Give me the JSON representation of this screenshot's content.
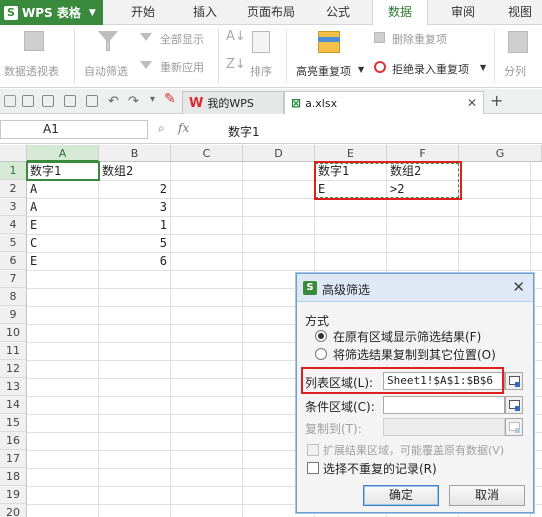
{
  "menubar": {
    "app_title": "WPS 表格",
    "tabs": [
      "开始",
      "插入",
      "页面布局",
      "公式",
      "数据",
      "审阅",
      "视图"
    ],
    "active_tab": "数据"
  },
  "ribbon": {
    "pivot": "数据透视表",
    "autofilter": "自动筛选",
    "show_all": "全部显示",
    "reapply": "重新应用",
    "sort": "排序",
    "highlight_dup": "高亮重复项",
    "remove_dup": "删除重复项",
    "reject_dup": "拒绝录入重复项",
    "split": "分列"
  },
  "doc_tabs": [
    {
      "label": "我的WPS"
    },
    {
      "label": "a.xlsx"
    }
  ],
  "formula_bar": {
    "cell_ref": "A1",
    "fx": "fx",
    "content": "数字1"
  },
  "sheet": {
    "columns": [
      "A",
      "B",
      "C",
      "D",
      "E",
      "F",
      "G"
    ],
    "rows": [
      "1",
      "2",
      "3",
      "4",
      "5",
      "6",
      "7",
      "8",
      "9",
      "10",
      "11",
      "12",
      "13",
      "14",
      "15",
      "16",
      "17",
      "18",
      "19",
      "20"
    ],
    "data_a": [
      "数字1",
      "A",
      "A",
      "E",
      "C",
      "E"
    ],
    "data_b": [
      "数组2",
      "2",
      "3",
      "1",
      "5",
      "6"
    ],
    "criteria_e": [
      "数字1",
      "E"
    ],
    "criteria_f": [
      "数组2",
      ">2"
    ]
  },
  "dialog": {
    "title": "高级筛选",
    "section": "方式",
    "option_in_place": "在原有区域显示筛选结果(F)",
    "option_copy": "将筛选结果复制到其它位置(O)",
    "list_range_label": "列表区域(L):",
    "list_range_value": "Sheet1!$A$1:$B$6",
    "criteria_range_label": "条件区域(C):",
    "copy_to_label": "复制到(T):",
    "expand_label": "扩展结果区域，可能覆盖原有数据(V)",
    "unique_label": "选择不重复的记录(R)",
    "ok": "确定",
    "cancel": "取消"
  },
  "colors": {
    "accent_green": "#3a8a3d",
    "highlight_red": "#e02020",
    "dialog_border": "#6f9fd0"
  }
}
